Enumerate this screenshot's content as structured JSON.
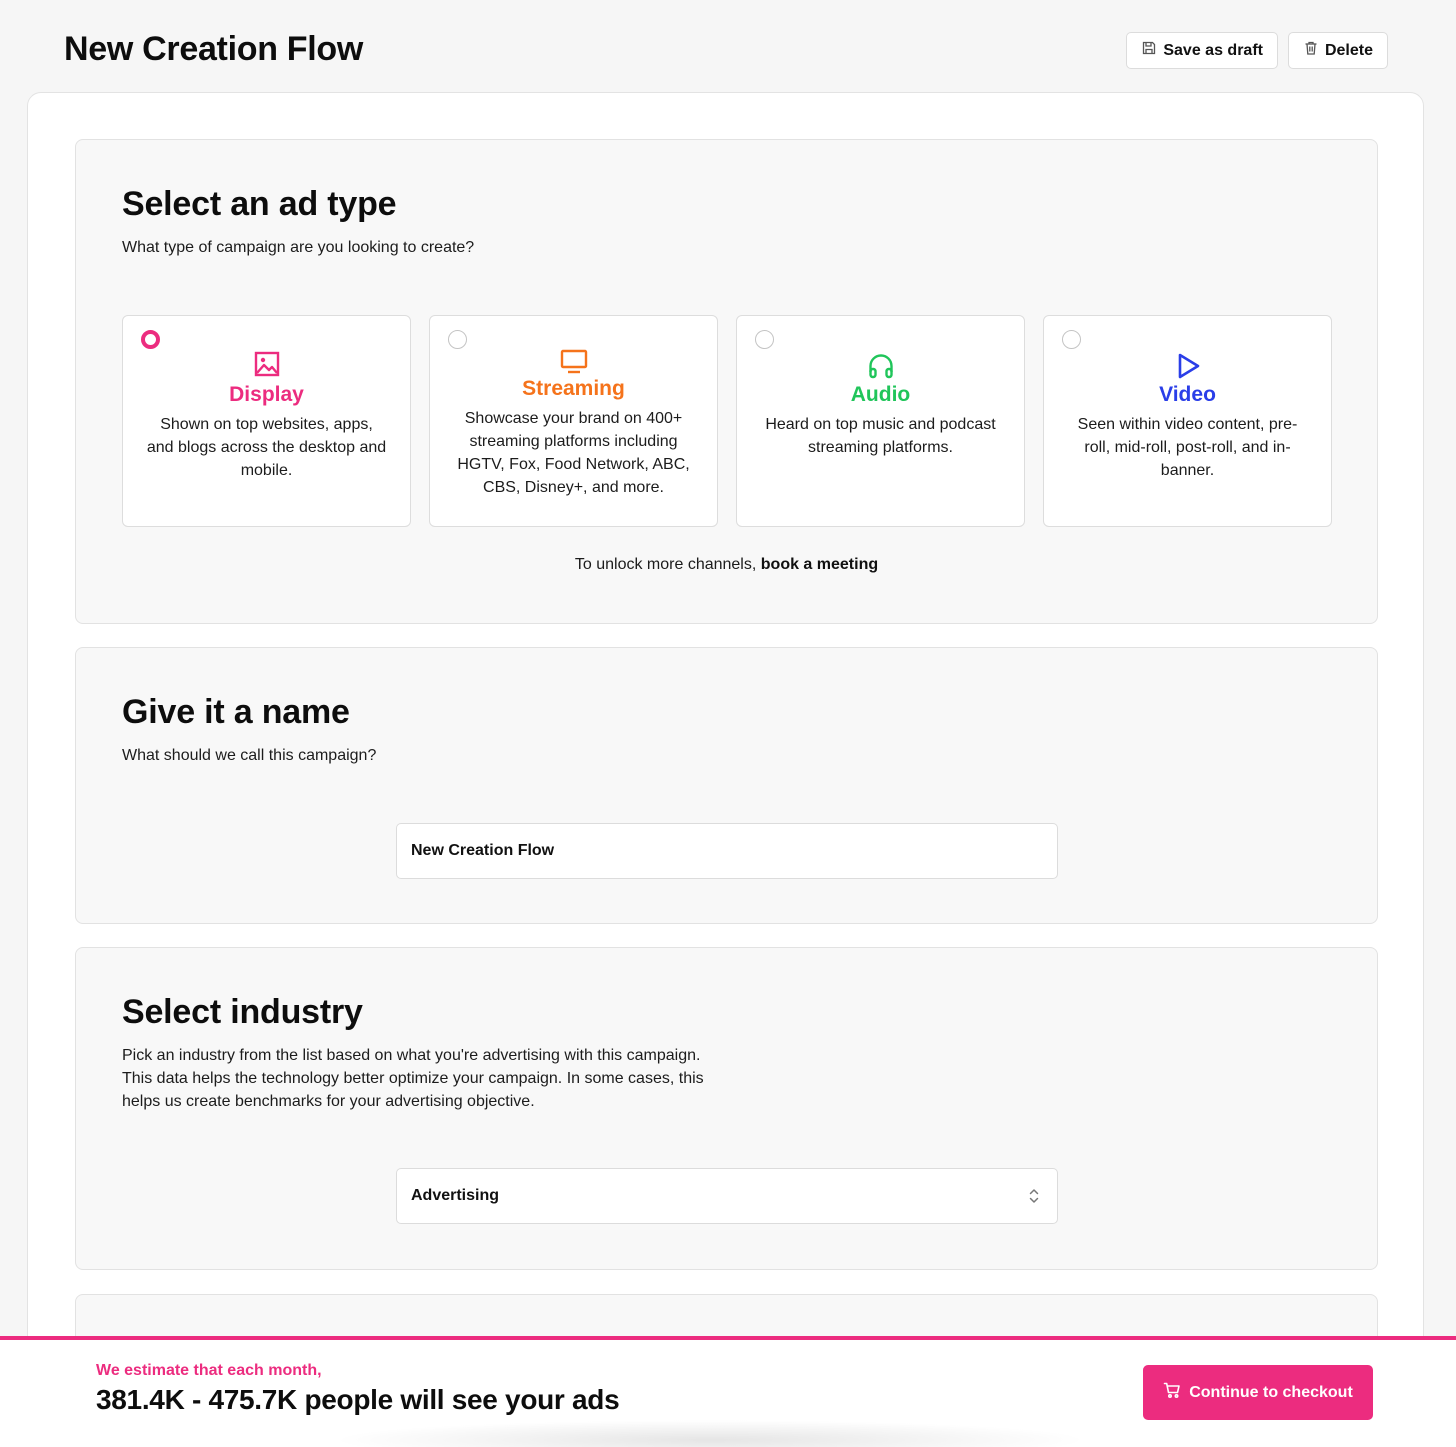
{
  "header": {
    "title": "New Creation Flow",
    "save_draft_label": "Save as draft",
    "delete_label": "Delete"
  },
  "ad_type_section": {
    "title": "Select an ad type",
    "subtitle": "What type of campaign are you looking to create?",
    "options": [
      {
        "label": "Display",
        "description": "Shown on top websites, apps, and blogs across the desktop and mobile.",
        "color": "#ec2c7f",
        "icon": "image-icon",
        "selected": true
      },
      {
        "label": "Streaming",
        "description": "Showcase your brand on 400+ streaming platforms including HGTV, Fox, Food Network, ABC, CBS, Disney+, and more.",
        "color": "#f5731b",
        "icon": "tv-icon",
        "selected": false
      },
      {
        "label": "Audio",
        "description": "Heard on top music and podcast streaming platforms.",
        "color": "#20c55a",
        "icon": "headphones-icon",
        "selected": false
      },
      {
        "label": "Video",
        "description": "Seen within video content, pre-roll, mid-roll, post-roll, and in-banner.",
        "color": "#2a3ee8",
        "icon": "play-icon",
        "selected": false
      }
    ],
    "unlock_text": "To unlock more channels,",
    "unlock_link": "book a meeting"
  },
  "name_section": {
    "title": "Give it a name",
    "subtitle": "What should we call this campaign?",
    "value": "New Creation Flow"
  },
  "industry_section": {
    "title": "Select industry",
    "subtitle": "Pick an industry from the list based on what you're advertising with this campaign. This data helps the technology better optimize your campaign. In some cases, this helps us create benchmarks for your advertising objective.",
    "selected": "Advertising"
  },
  "footer": {
    "estimate_label": "We estimate that each month,",
    "estimate_value": "381.4K - 475.7K people will see your ads",
    "checkout_label": "Continue to checkout"
  },
  "colors": {
    "accent": "#ec2c7f"
  }
}
